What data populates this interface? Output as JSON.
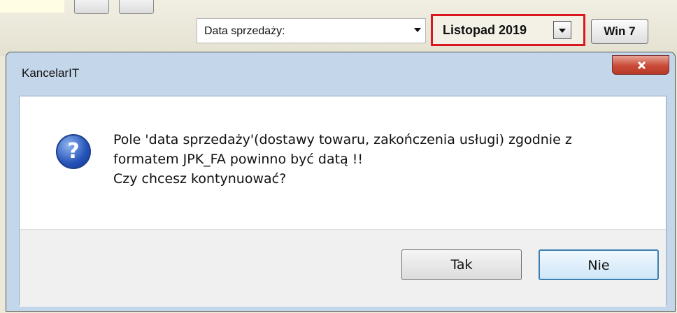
{
  "background": {
    "sale_date_dropdown": "Data sprzedaży:",
    "month_dropdown": "Listopad 2019",
    "os_button": "Win 7"
  },
  "dialog": {
    "title": "KancelarIT",
    "icon": "question-icon",
    "message_lines": [
      "Pole 'data sprzedaży'(dostawy towaru, zakończenia usługi) zgodnie z",
      "formatem JPK_FA powinno być datą !!",
      "Czy chcesz kontynuować?"
    ],
    "buttons": {
      "yes": "Tak",
      "no": "Nie"
    }
  },
  "colors": {
    "highlight": "#d9191f",
    "dialog_frame": "#c4d6ea",
    "close_button": "#c94a37"
  }
}
